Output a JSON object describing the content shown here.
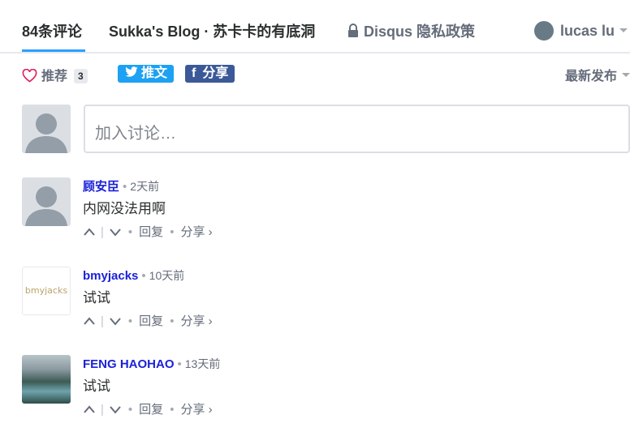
{
  "nav": {
    "comment_count_tab": "84条评论",
    "forum_tab": "Sukka's Blog · 苏卡卡的有底洞",
    "privacy_link": "Disqus 隐私政策",
    "user_name": "lucas lu"
  },
  "actions": {
    "recommend_label": "推荐",
    "recommend_count": "3",
    "tweet_label": "推文",
    "facebook_label": "分享",
    "facebook_glyph": "f",
    "sort_label": "最新发布"
  },
  "composer": {
    "placeholder": "加入讨论…"
  },
  "comments": [
    {
      "author": "顾安臣",
      "time": "2天前",
      "text": "内网没法用啊",
      "avatar": "default-avatar"
    },
    {
      "author": "bmyjacks",
      "time": "10天前",
      "text": "试试",
      "avatar": "logo-avatar",
      "avatar_text": "bmyjacks"
    },
    {
      "author": "FENG HAOHAO",
      "time": "13天前",
      "text": "试试",
      "avatar": "photo-avatar"
    }
  ],
  "comment_actions": {
    "separator": "|",
    "bullet": "•",
    "reply": "回复",
    "share": "分享 ›"
  },
  "colors": {
    "accent": "#2e9fff",
    "author": "#1b21d8",
    "twitter": "#1da1f2",
    "facebook": "#3b5998",
    "heart": "#e0245e"
  }
}
